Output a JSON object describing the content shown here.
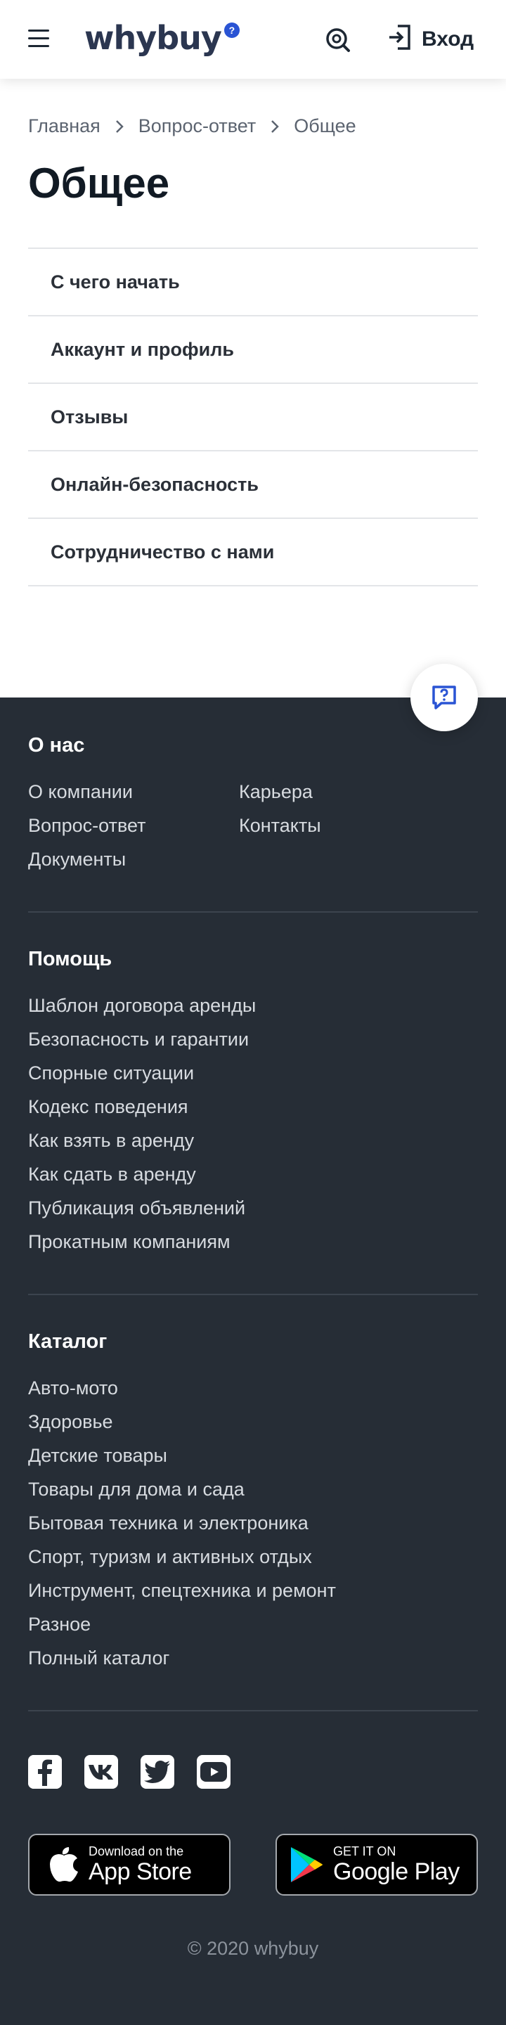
{
  "header": {
    "logo_text": "whybuy",
    "logo_badge": "?",
    "login_label": "Вход"
  },
  "breadcrumb": [
    "Главная",
    "Вопрос-ответ",
    "Общее"
  ],
  "page_title": "Общее",
  "faq_items": [
    "С чего начать",
    "Аккаунт и профиль",
    "Отзывы",
    "Онлайн-безопасность",
    "Сотрудничество с нами"
  ],
  "footer": {
    "about": {
      "title": "О нас",
      "col1": [
        "О компании",
        "Вопрос-ответ",
        "Документы"
      ],
      "col2": [
        "Карьера",
        "Контакты"
      ]
    },
    "help": {
      "title": "Помощь",
      "links": [
        "Шаблон договора аренды",
        "Безопасность и гарантии",
        "Спорные ситуации",
        "Кодекс поведения",
        "Как взять в аренду",
        "Как сдать в аренду",
        "Публикация объявлений",
        "Прокатным компаниям"
      ]
    },
    "catalog": {
      "title": "Каталог",
      "links": [
        "Авто-мото",
        "Здоровье",
        "Детские товары",
        "Товары для дома и сада",
        "Бытовая техника и электроника",
        "Спорт, туризм и активных отдых",
        "Инструмент, спецтехника и ремонт",
        "Разное",
        "Полный каталог"
      ]
    },
    "social_icons": [
      "facebook-icon",
      "vk-icon",
      "twitter-icon",
      "youtube-icon"
    ],
    "app_store": {
      "small": "Download on the",
      "big": "App Store"
    },
    "google_play": {
      "small": "GET IT ON",
      "big": "Google Play"
    },
    "copyright": "© 2020 whybuy"
  },
  "colors": {
    "accent": "#2a54d4",
    "footer_bg": "#262d36",
    "text_dark": "#1d2733"
  }
}
